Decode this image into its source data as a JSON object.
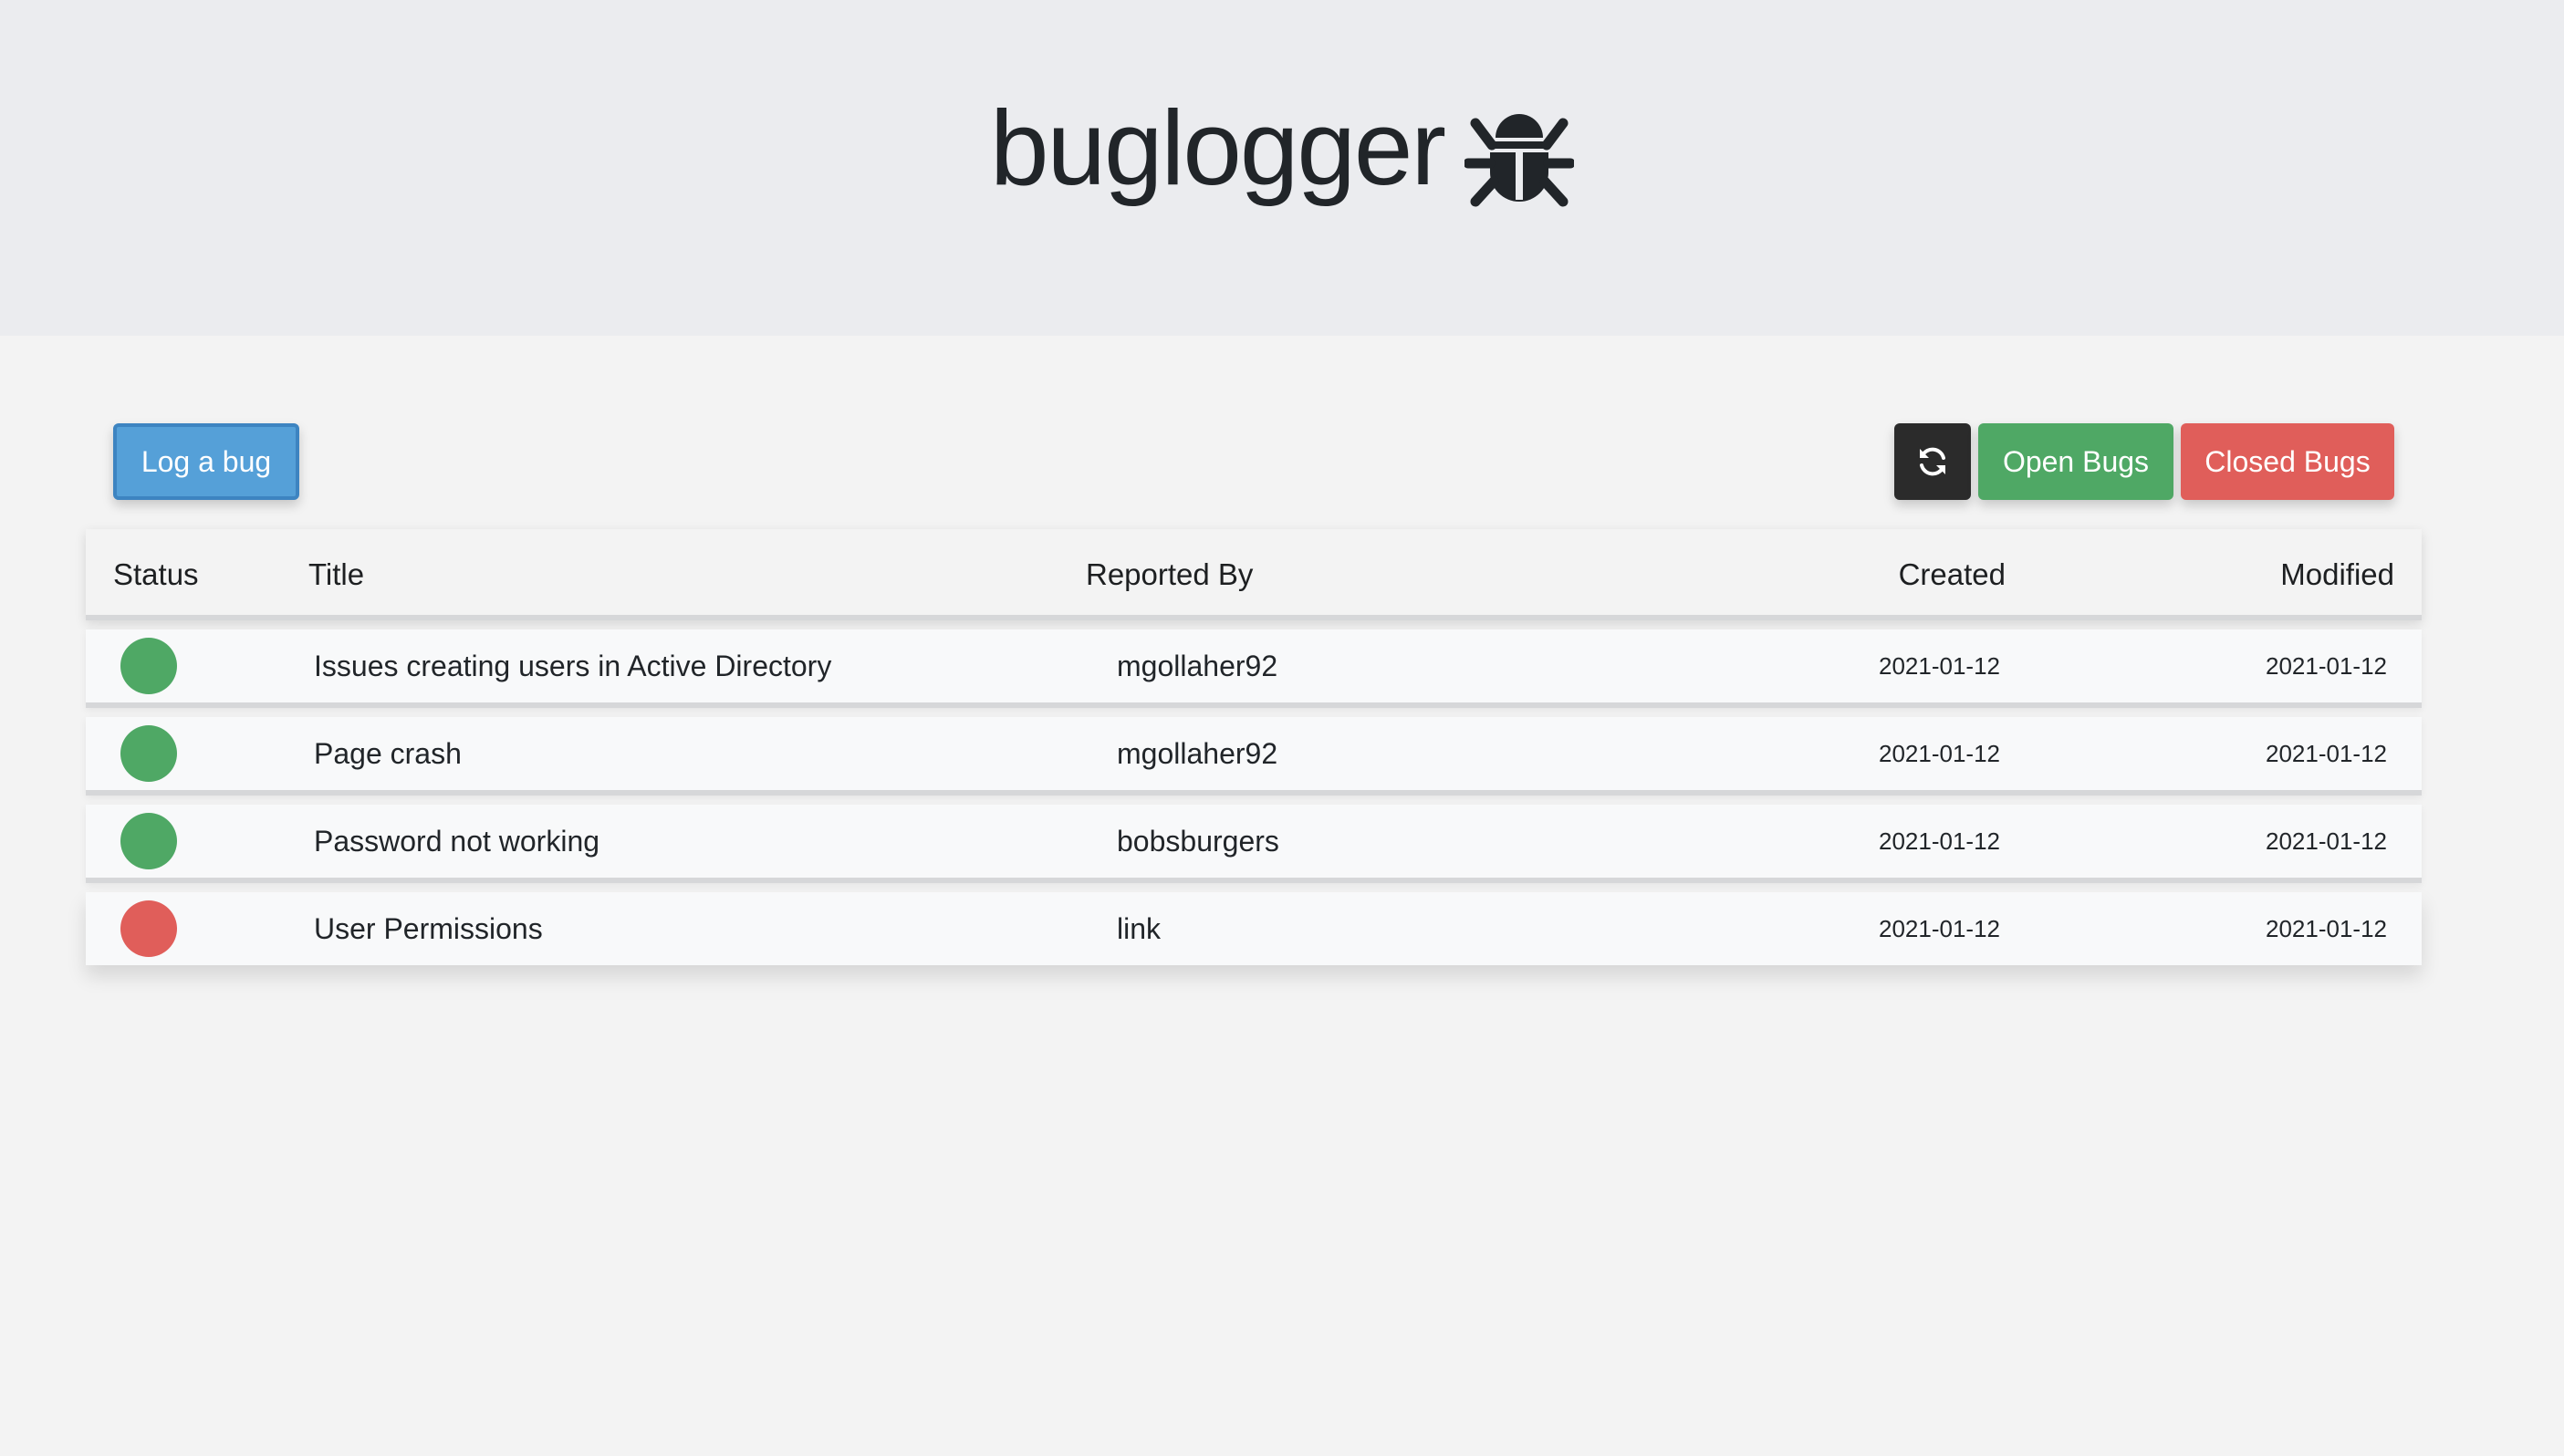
{
  "app": {
    "title": "buglogger",
    "logo_icon": "bug-icon"
  },
  "toolbar": {
    "log_button_label": "Log a bug",
    "refresh_icon": "refresh-icon",
    "open_bugs_label": "Open Bugs",
    "closed_bugs_label": "Closed Bugs"
  },
  "colors": {
    "log_button": "#55a0d8",
    "refresh_button": "#2b2b2b",
    "open_status": "#4fa865",
    "closed_status": "#e05e5a"
  },
  "table": {
    "columns": {
      "status": "Status",
      "title": "Title",
      "reported_by": "Reported By",
      "created": "Created",
      "modified": "Modified"
    },
    "rows": [
      {
        "status": "open",
        "status_color": "#4fa865",
        "title": "Issues creating users in Active Directory",
        "reported_by": "mgollaher92",
        "created": "2021-01-12",
        "modified": "2021-01-12"
      },
      {
        "status": "open",
        "status_color": "#4fa865",
        "title": "Page crash",
        "reported_by": "mgollaher92",
        "created": "2021-01-12",
        "modified": "2021-01-12"
      },
      {
        "status": "open",
        "status_color": "#4fa865",
        "title": "Password not working",
        "reported_by": "bobsburgers",
        "created": "2021-01-12",
        "modified": "2021-01-12"
      },
      {
        "status": "closed",
        "status_color": "#e05e5a",
        "title": "User Permissions",
        "reported_by": "link",
        "created": "2021-01-12",
        "modified": "2021-01-12"
      }
    ]
  }
}
